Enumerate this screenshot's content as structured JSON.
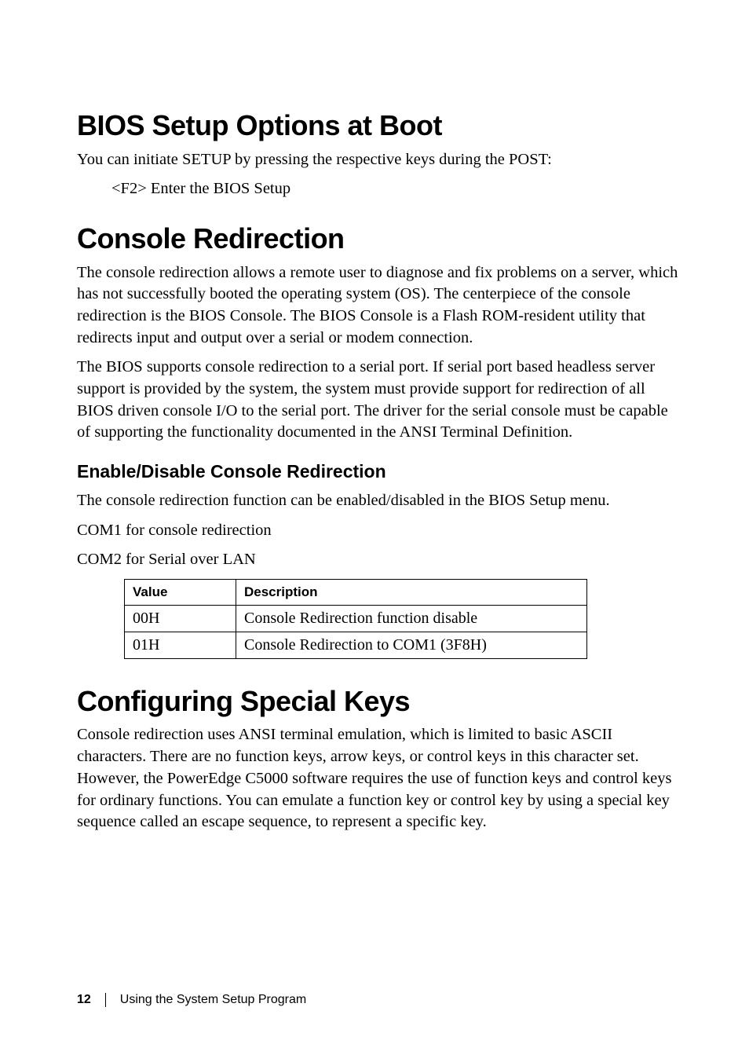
{
  "h1_1": "BIOS Setup Options at Boot",
  "p1": "You can initiate SETUP by pressing the respective keys during the POST:",
  "p1_indent": "<F2> Enter the BIOS Setup",
  "h1_2": "Console Redirection",
  "p2": "The console redirection allows a remote user to diagnose and fix problems on a server, which has not successfully booted the operating system (OS). The centerpiece of the console redirection is the BIOS Console. The BIOS Console is a Flash ROM-resident utility that redirects input and output over a serial or modem connection.",
  "p3": "The BIOS supports console redirection to a serial port. If serial port based headless server support is provided by the system, the system must provide support for redirection of all BIOS driven console I/O to the serial port. The driver for the serial console must be capable of supporting the functionality documented in the ANSI Terminal Definition.",
  "h2_1": "Enable/Disable Console Redirection",
  "p4": "The console redirection function can be enabled/disabled in the BIOS Setup menu.",
  "p5": "COM1 for console redirection",
  "p6": "COM2 for Serial over LAN",
  "table": {
    "headers": {
      "value": "Value",
      "description": "Description"
    },
    "rows": [
      {
        "value": "00H",
        "description": "Console Redirection function disable"
      },
      {
        "value": "01H",
        "description": "Console Redirection to COM1 (3F8H)"
      }
    ]
  },
  "h1_3": "Configuring Special Keys",
  "p7": "Console redirection uses ANSI terminal emulation, which is limited to basic ASCII characters. There are no function keys, arrow keys, or control keys in this character set. However, the PowerEdge C5000 software requires the use of function keys and control keys for ordinary functions. You can emulate a function key or control key by using a special key sequence called an escape sequence, to represent a specific key.",
  "footer": {
    "page": "12",
    "section": "Using the System Setup Program"
  }
}
